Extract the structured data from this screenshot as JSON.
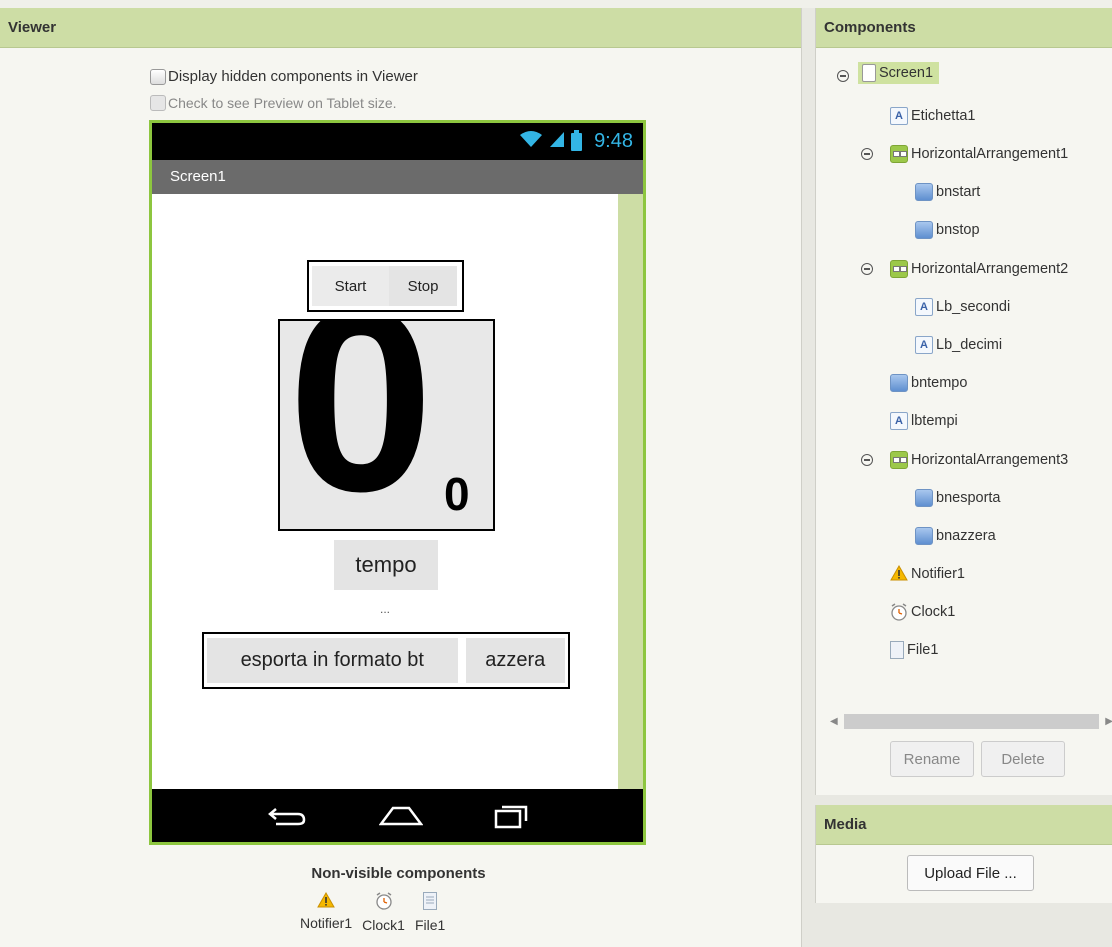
{
  "viewer": {
    "title": "Viewer",
    "display_hidden_label": "Display hidden components in Viewer",
    "tablet_preview_label": "Check to see Preview on Tablet size."
  },
  "phone": {
    "status_time": "9:48",
    "screen_title": "Screen1",
    "start_label": "Start",
    "stop_label": "Stop",
    "big_digit": "0",
    "small_digit": "0",
    "tempo_label": "tempo",
    "lbtempi_text": "...",
    "esporta_label": "esporta in formato bt",
    "azzera_label": "azzera"
  },
  "nonvisible": {
    "title": "Non-visible components",
    "items": [
      "Notifier1",
      "Clock1",
      "File1"
    ]
  },
  "components": {
    "title": "Components",
    "tree": [
      "Screen1",
      "Etichetta1",
      "HorizontalArrangement1",
      "bnstart",
      "bnstop",
      "HorizontalArrangement2",
      "Lb_secondi",
      "Lb_decimi",
      "bntempo",
      "lbtempi",
      "HorizontalArrangement3",
      "bnesporta",
      "bnazzera",
      "Notifier1",
      "Clock1",
      "File1"
    ],
    "rename_label": "Rename",
    "delete_label": "Delete"
  },
  "media": {
    "title": "Media",
    "upload_label": "Upload File ..."
  },
  "colors": {
    "accent_green": "#8dc63f",
    "header_green": "#cddda5",
    "status_blue": "#33b5e5"
  }
}
